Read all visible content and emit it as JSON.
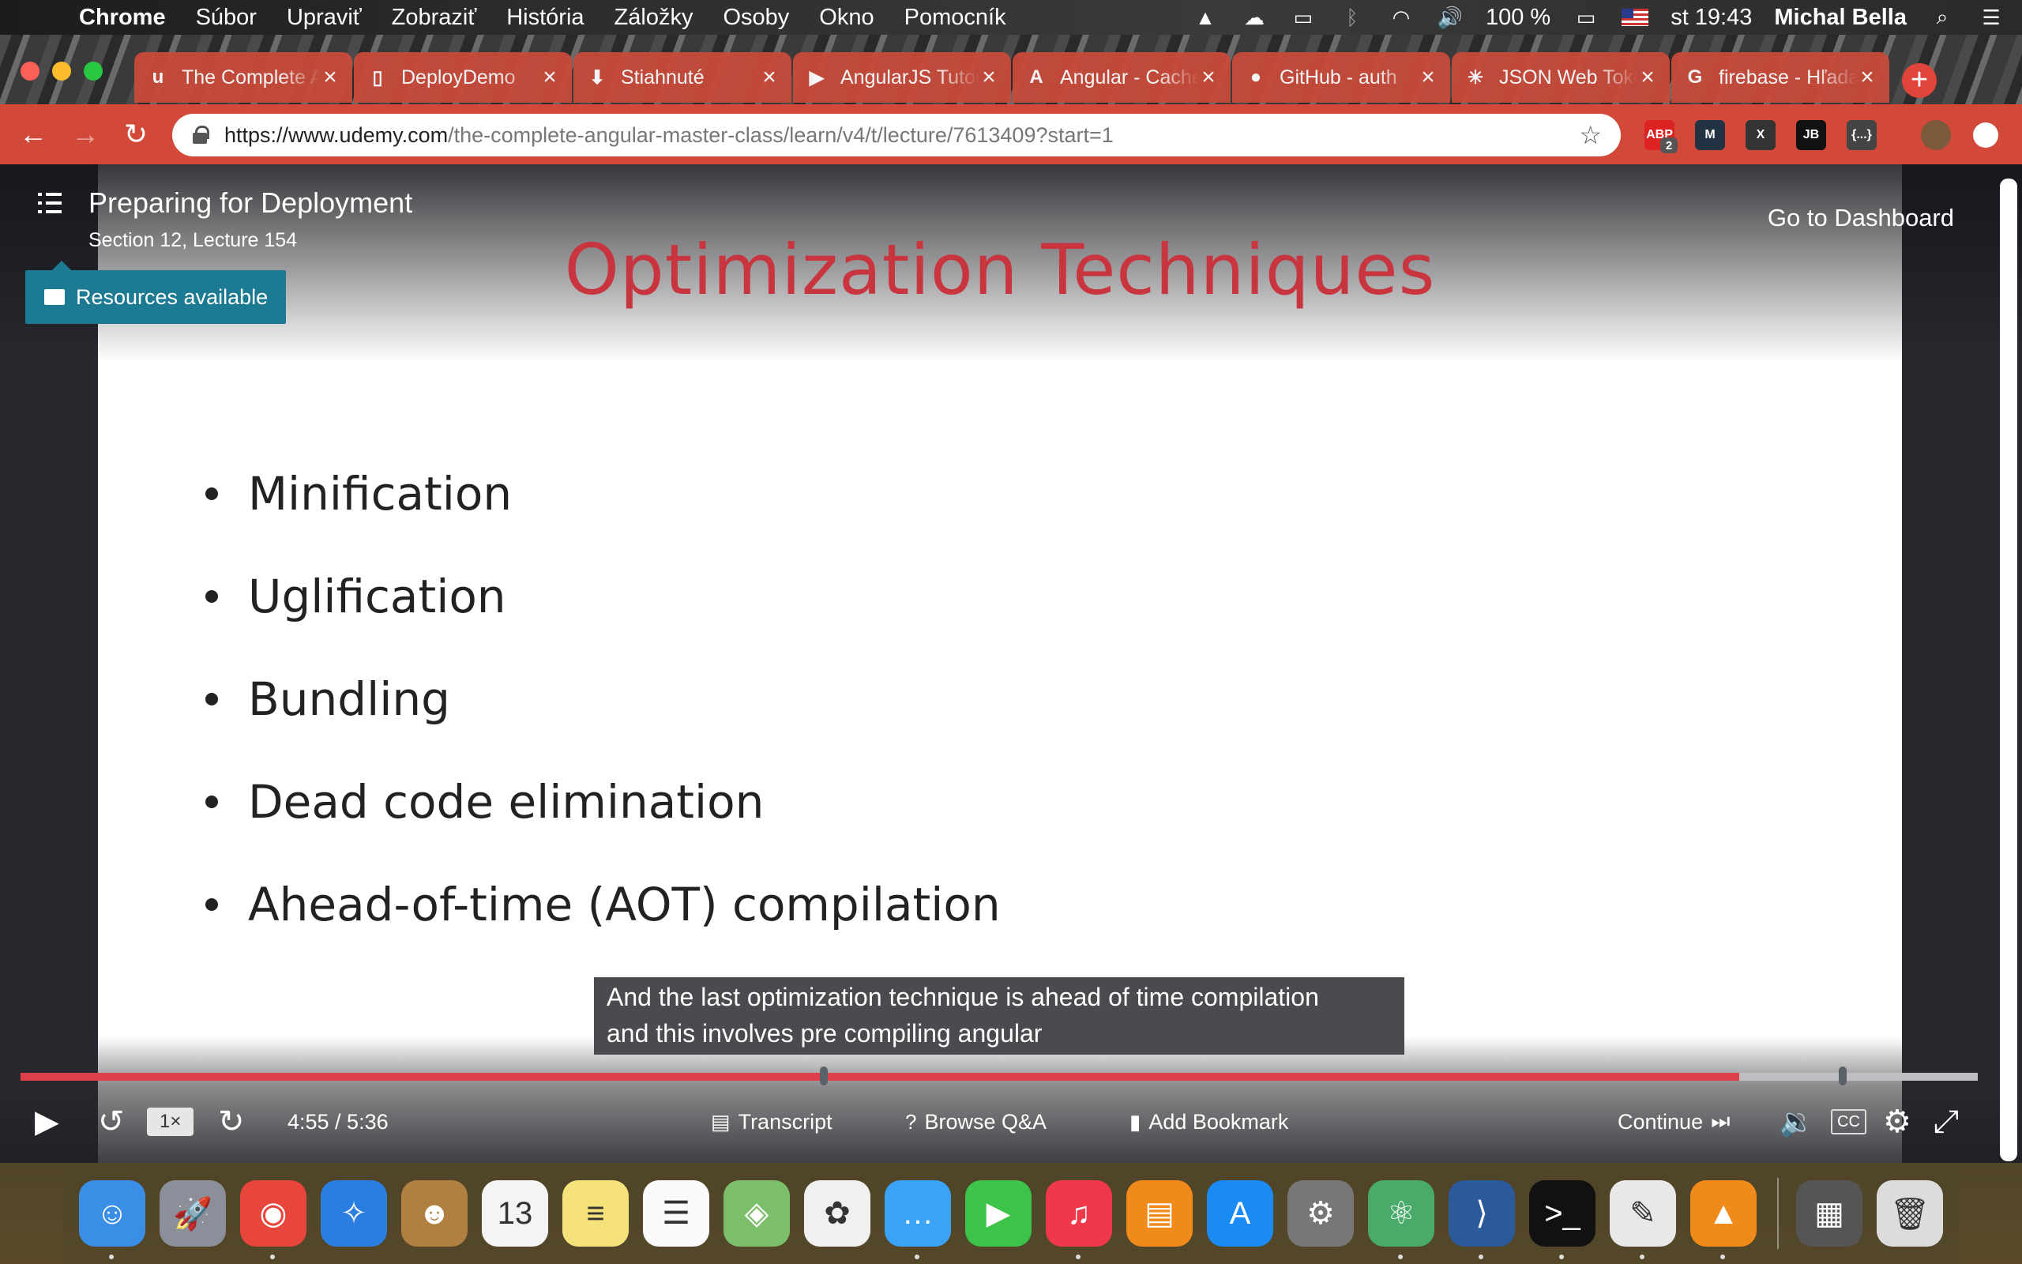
{
  "menubar": {
    "app_name": "Chrome",
    "menus": [
      "Súbor",
      "Upraviť",
      "Zobraziť",
      "História",
      "Záložky",
      "Osoby",
      "Okno",
      "Pomocník"
    ],
    "battery": "100 %",
    "clock": "st 19:43",
    "user": "Michal Bella"
  },
  "tabs": [
    {
      "title": "The Complete Angular Master Class",
      "icon": "udemy-icon",
      "glyph": "u",
      "active": true
    },
    {
      "title": "DeployDemo",
      "icon": "page-icon",
      "glyph": "▯"
    },
    {
      "title": "Stiahnuté",
      "icon": "download-icon",
      "glyph": "⬇"
    },
    {
      "title": "AngularJS Tutorial",
      "icon": "youtube-icon",
      "glyph": "▶"
    },
    {
      "title": "Angular - Cache",
      "icon": "angular-icon",
      "glyph": "A"
    },
    {
      "title": "GitHub - auth",
      "icon": "github-icon",
      "glyph": "●"
    },
    {
      "title": "JSON Web Tokens",
      "icon": "jwt-icon",
      "glyph": "✳"
    },
    {
      "title": "firebase - Hľadať",
      "icon": "google-icon",
      "glyph": "G"
    }
  ],
  "toolbar": {
    "url_host": "https://www.udemy.com",
    "url_path": "/the-complete-angular-master-class/learn/v4/t/lecture/7613409?start=1",
    "extensions": [
      {
        "name": "adblock-extension-icon",
        "label": "ABP",
        "badge": "2",
        "color": "#d22"
      },
      {
        "name": "mailtrack-extension-icon",
        "label": "M",
        "color": "#234"
      },
      {
        "name": "x-extension-icon",
        "label": "X",
        "color": "#333"
      },
      {
        "name": "jetbrains-extension-icon",
        "label": "JB",
        "color": "#111"
      },
      {
        "name": "json-extension-icon",
        "label": "{...}",
        "color": "#444"
      }
    ]
  },
  "lecture": {
    "title": "Preparing for Deployment",
    "subtitle": "Section 12, Lecture 154",
    "dashboard_link": "Go to Dashboard",
    "resources_label": "Resources available"
  },
  "slide": {
    "title": "Optimization Techniques",
    "bullets": [
      "Minification",
      "Uglification",
      "Bundling",
      "Dead code elimination",
      "Ahead-of-time (AOT) compilation"
    ]
  },
  "caption": {
    "line1": "And the last optimization technique is ahead of time compilation",
    "line2": "and this involves pre compiling angular"
  },
  "player": {
    "progress": 0.878,
    "speed": "1×",
    "time": "4:55 / 5:36",
    "transcript": "Transcript",
    "browse_qa": "Browse Q&A",
    "add_bookmark": "Add Bookmark",
    "continue": "Continue",
    "cc": "CC",
    "accent": "#e0404a"
  },
  "dock": {
    "apps": [
      {
        "name": "finder-icon",
        "color": "#3a8ee6",
        "glyph": "☺",
        "running": true
      },
      {
        "name": "launchpad-icon",
        "color": "#8a8f99",
        "glyph": "🚀",
        "running": false
      },
      {
        "name": "chrome-icon",
        "color": "#e8453c",
        "glyph": "◉",
        "running": true
      },
      {
        "name": "safari-icon",
        "color": "#2a7de1",
        "glyph": "✧",
        "running": false
      },
      {
        "name": "contacts-icon",
        "color": "#b08040",
        "glyph": "☻",
        "running": false
      },
      {
        "name": "calendar-icon",
        "color": "#f4f4f4",
        "glyph": "13",
        "running": false
      },
      {
        "name": "notes-icon",
        "color": "#f6e27a",
        "glyph": "≡",
        "running": false
      },
      {
        "name": "reminders-icon",
        "color": "#fafafa",
        "glyph": "☰",
        "running": false
      },
      {
        "name": "maps-icon",
        "color": "#7cbf6a",
        "glyph": "◈",
        "running": false
      },
      {
        "name": "photos-icon",
        "color": "#f0f0f0",
        "glyph": "✿",
        "running": false
      },
      {
        "name": "messages-icon",
        "color": "#3aa3f5",
        "glyph": "…",
        "running": true
      },
      {
        "name": "facetime-icon",
        "color": "#3cc34a",
        "glyph": "▶",
        "running": false
      },
      {
        "name": "itunes-icon",
        "color": "#f0384a",
        "glyph": "♫",
        "running": true
      },
      {
        "name": "ibooks-icon",
        "color": "#f08a1a",
        "glyph": "▤",
        "running": false
      },
      {
        "name": "app-store-icon",
        "color": "#1a8af5",
        "glyph": "A",
        "running": false
      },
      {
        "name": "system-preferences-icon",
        "color": "#777",
        "glyph": "⚙",
        "running": false
      },
      {
        "name": "atom-icon",
        "color": "#4aaa6a",
        "glyph": "⚛",
        "running": true
      },
      {
        "name": "vscode-icon",
        "color": "#2a5a9a",
        "glyph": "⟩",
        "running": true
      },
      {
        "name": "terminal-icon",
        "color": "#111",
        "glyph": ">_",
        "running": true
      },
      {
        "name": "textedit-icon",
        "color": "#e8e8e8",
        "glyph": "✎",
        "running": true
      },
      {
        "name": "vlc-icon",
        "color": "#f08a1a",
        "glyph": "▲",
        "running": true
      }
    ],
    "trailing": [
      {
        "name": "downloads-stack-icon",
        "color": "#555",
        "glyph": "▦"
      },
      {
        "name": "trash-icon",
        "color": "#dcdcdc",
        "glyph": "🗑"
      }
    ]
  }
}
